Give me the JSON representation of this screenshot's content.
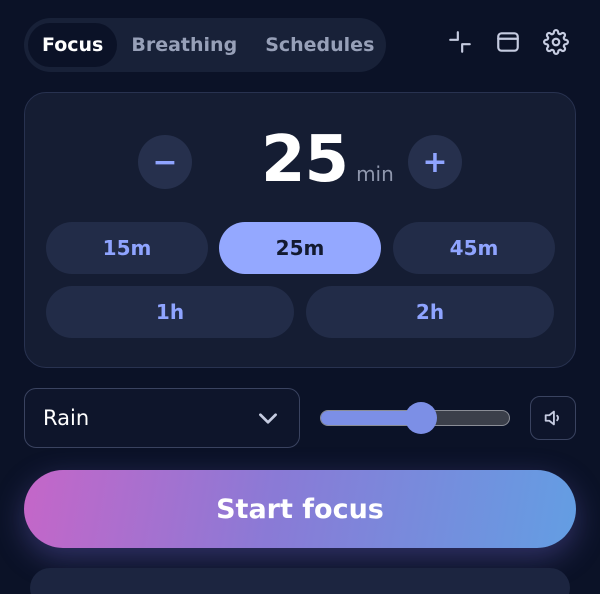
{
  "tabs": [
    {
      "label": "Focus",
      "active": true
    },
    {
      "label": "Breathing",
      "active": false
    },
    {
      "label": "Schedules",
      "active": false
    }
  ],
  "timer": {
    "value": "25",
    "unit": "min",
    "minus_label": "−",
    "plus_label": "+",
    "presets": [
      "15m",
      "25m",
      "45m",
      "1h",
      "2h"
    ],
    "selected_preset": "25m"
  },
  "sound": {
    "selected": "Rain",
    "volume_percent": 53
  },
  "start_button": {
    "label": "Start focus"
  },
  "icons": {
    "collapse": "collapse-icon",
    "window": "window-icon",
    "settings": "gear-icon",
    "dropdown": "chevron-down-icon",
    "volume": "speaker-icon"
  },
  "colors": {
    "background": "#0b1227",
    "accent": "#94a8ff",
    "gradient_start": "#c566c8",
    "gradient_end": "#639ee3"
  }
}
